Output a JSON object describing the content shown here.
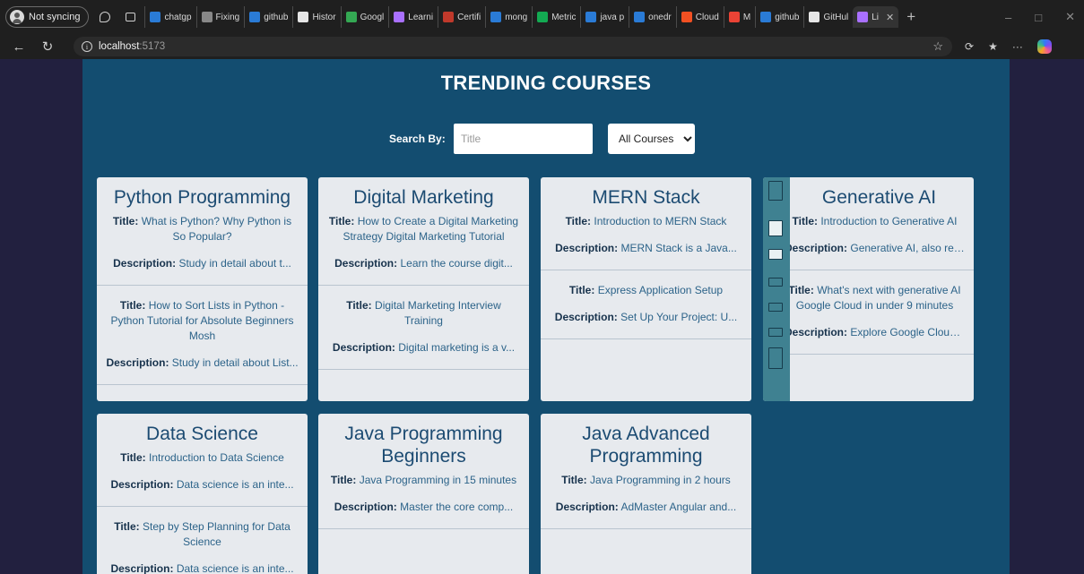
{
  "browser": {
    "profile_label": "Not syncing",
    "tabs": [
      {
        "label": "chatgp",
        "color": "#2a7bd6"
      },
      {
        "label": "Fixing",
        "color": "#888888"
      },
      {
        "label": "github",
        "color": "#2a7bd6"
      },
      {
        "label": "Histor",
        "color": "#e6e6e6"
      },
      {
        "label": "Googl",
        "color": "#34a853"
      },
      {
        "label": "Learni",
        "color": "#a970ff"
      },
      {
        "label": "Certifi",
        "color": "#c0392b"
      },
      {
        "label": "mong",
        "color": "#2a7bd6"
      },
      {
        "label": "Metric",
        "color": "#13aa52"
      },
      {
        "label": "java p",
        "color": "#2a7bd6"
      },
      {
        "label": "onedr",
        "color": "#2a7bd6"
      },
      {
        "label": "Cloud",
        "color": "#f25022"
      },
      {
        "label": "M",
        "color": "#ea4335"
      },
      {
        "label": "github",
        "color": "#2a7bd6"
      },
      {
        "label": "GitHul",
        "color": "#e6e6e6"
      },
      {
        "label": "Li",
        "color": "#a970ff",
        "active": true
      }
    ],
    "url_host": "localhost",
    "url_port": ":5173"
  },
  "page": {
    "title": "TRENDING COURSES",
    "search_label": "Search By:",
    "search_placeholder": "Title",
    "filter_selected": "All Courses"
  },
  "courses": [
    {
      "name": "Python Programming",
      "videos": [
        {
          "title_label": "Title:",
          "title": "What is Python? Why Python is So Popular?",
          "desc_label": "Description:",
          "description": "Study in detail about t..."
        },
        {
          "title_label": "Title:",
          "title": "How to Sort Lists in Python - Python Tutorial for Absolute Beginners Mosh",
          "desc_label": "Description:",
          "description": "Study in detail about List..."
        }
      ]
    },
    {
      "name": "Digital Marketing",
      "videos": [
        {
          "title_label": "Title:",
          "title": "How to Create a Digital Marketing Strategy Digital Marketing Tutorial",
          "desc_label": "Description:",
          "description": "Learn the course digit..."
        },
        {
          "title_label": "Title:",
          "title": "Digital Marketing Interview Training",
          "desc_label": "Description:",
          "description": "Digital marketing is a v..."
        }
      ]
    },
    {
      "name": "MERN Stack",
      "videos": [
        {
          "title_label": "Title:",
          "title": "Introduction to MERN Stack",
          "desc_label": "Description:",
          "description": "MERN Stack is a Java..."
        },
        {
          "title_label": "Title:",
          "title": "Express Application Setup",
          "desc_label": "Description:",
          "description": "Set Up Your Project: U..."
        }
      ]
    },
    {
      "name": "Generative AI",
      "videos": [
        {
          "title_label": "Title:",
          "title": "Introduction to Generative AI",
          "desc_label": "Description:",
          "description": "Generative AI, also ref..."
        },
        {
          "title_label": "Title:",
          "title": "What's next with generative AI Google Cloud in under 9 minutes",
          "desc_label": "Description:",
          "description": "Explore Google Cloud'..."
        }
      ]
    },
    {
      "name": "Data Science",
      "videos": [
        {
          "title_label": "Title:",
          "title": "Introduction to Data Science",
          "desc_label": "Description:",
          "description": "Data science is an inte..."
        },
        {
          "title_label": "Title:",
          "title": "Step by Step Planning for Data Science",
          "desc_label": "Description:",
          "description": "Data science is an inte..."
        }
      ]
    },
    {
      "name": "Java Programming Beginners",
      "videos": [
        {
          "title_label": "Title:",
          "title": "Java Programming in 15 minutes",
          "desc_label": "Description:",
          "description": "Master the core comp..."
        }
      ]
    },
    {
      "name": "Java Advanced Programming",
      "videos": [
        {
          "title_label": "Title:",
          "title": "Java Programming in 2 hours",
          "desc_label": "Description:",
          "description": "AdMaster Angular and..."
        }
      ]
    }
  ]
}
